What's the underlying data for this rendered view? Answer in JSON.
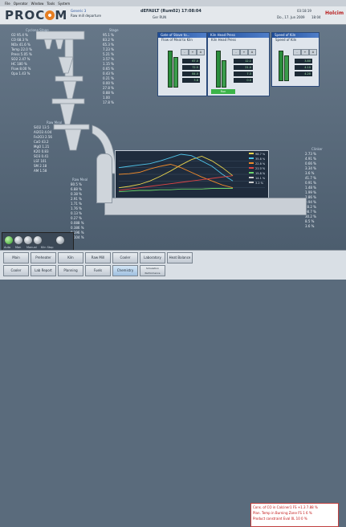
{
  "menu": [
    "File",
    "Operator",
    "Window",
    "Tools",
    "System"
  ],
  "header": {
    "app_name": "PROCEM",
    "left_lines": [
      "Generic 3",
      "Raw mill departure"
    ],
    "center_line1": "Rapid Analysis Departure",
    "title": "dEFAULT (Rum02) 17:08:04",
    "title_sub": "Ger RUN",
    "time": "03:18:19",
    "date": "Do., 17. Jun 2009",
    "date_sub": "18:04",
    "brand_right": "Holcim"
  },
  "panels": [
    {
      "title": "Gate of Stave to...",
      "sub": "Flow of Meal to Kiln",
      "values": [
        "67.0",
        "72.5",
        "84.0",
        "3.8"
      ]
    },
    {
      "title": "Kiln Head Press",
      "sub": "Kiln Head Press",
      "values": [
        "12.1",
        "21.0",
        "7.3",
        "0.0"
      ],
      "status": "Run"
    },
    {
      "title": "Speed of Kiln",
      "sub": "Speed of Kiln",
      "values": [
        "3.80",
        "4.10",
        "4.20",
        "6.0"
      ]
    }
  ],
  "left_values": {
    "header": "Cyclone Stage",
    "rows": [
      {
        "name": "O2",
        "val": "95.4 %"
      },
      {
        "name": "CO",
        "val": "68.3 %"
      },
      {
        "name": "NOx",
        "val": "41.6 %"
      },
      {
        "name": "Temp",
        "val": "22.0 %"
      },
      {
        "name": "Press",
        "val": "5.05 %"
      },
      {
        "name": "SO2",
        "val": "2.47 %"
      },
      {
        "name": "HC",
        "val": "180 %"
      },
      {
        "name": "Flow",
        "val": "8.00 %"
      },
      {
        "name": "Opa",
        "val": "1.43 %"
      }
    ]
  },
  "center_values": {
    "header": "Stage",
    "rows": [
      "95.1 %",
      "83.2 %",
      "65.3 %",
      "7.23 %",
      "5.21 %",
      "3.57 %",
      "1.15 %",
      "0.65 %",
      "0.43 %",
      "0.21 %",
      "0.00 %",
      "27.8 %",
      "0.88 %",
      "1.00",
      "17.8 %"
    ]
  },
  "lower_left": {
    "header": "Raw Meal",
    "rows": [
      {
        "name": "SiO2",
        "val": "13.5"
      },
      {
        "name": "Al2O3",
        "val": "4.04"
      },
      {
        "name": "Fe2O3",
        "val": "2.56"
      },
      {
        "name": "CaO",
        "val": "43.2"
      },
      {
        "name": "MgO",
        "val": "1.21"
      },
      {
        "name": "K2O",
        "val": "0.83"
      },
      {
        "name": "SO3",
        "val": "0.41"
      },
      {
        "name": "LSF",
        "val": "101"
      },
      {
        "name": "SM",
        "val": "2.18"
      },
      {
        "name": "AM",
        "val": "1.58"
      }
    ]
  },
  "lower_mid": {
    "header": "Raw Meal",
    "rows": [
      "80.5 %",
      "6.88 %",
      "0.38 %",
      "2.91 %",
      "1.71 %",
      "1.76 %",
      "0.13 %",
      "0.27 %",
      "0.088 %",
      "0.386 %",
      "0.196 %",
      "0.104 %"
    ]
  },
  "right_values": {
    "header": "Clinker",
    "rows": [
      "2.73 %",
      "4.91 %",
      "0.66 %",
      "3.34 %",
      "3.6 %",
      "41.7 %",
      "0.91 %",
      "1.48 %",
      "1.99 %",
      "2.86 %",
      "0.94 %",
      "28.2 %",
      "98.7 %",
      "30.2 %",
      "8.5 %",
      "3.6 %"
    ]
  },
  "chart_data": {
    "type": "line",
    "series": [
      {
        "name": "",
        "color": "#e8d44d",
        "values": [
          10,
          12,
          15,
          20,
          27,
          35,
          44,
          52,
          57,
          50,
          40,
          28
        ]
      },
      {
        "name": "",
        "color": "#4fc3e8",
        "values": [
          40,
          42,
          44,
          46,
          50,
          55,
          60,
          58,
          50,
          42,
          30,
          20
        ]
      },
      {
        "name": "",
        "color": "#f08a2a",
        "values": [
          30,
          31,
          33,
          38,
          42,
          45,
          40,
          33,
          26,
          20,
          14,
          10
        ]
      },
      {
        "name": "",
        "color": "#d44",
        "values": [
          6,
          8,
          10,
          12,
          14,
          16,
          18,
          20,
          22,
          24,
          26,
          28
        ]
      },
      {
        "name": "",
        "color": "#6bd46b",
        "values": [
          4,
          5,
          6,
          6,
          7,
          7,
          8,
          8,
          8,
          9,
          9,
          9
        ]
      }
    ],
    "legend": [
      "98.7 %",
      "35.8 %",
      "22.8 %",
      "21.0 %",
      "15.8 %",
      "14.1 %",
      "3.2 %"
    ]
  },
  "footer": {
    "row1": [
      "Main",
      "Preheater",
      "Kiln",
      "Raw Mill",
      "Cooler",
      "Laboratory",
      "Heat Balance"
    ],
    "row2": [
      "Cooler",
      "Lab Report",
      "Planning",
      "Fuels",
      "Chemistry",
      "Simulation Performance"
    ],
    "alarm_lines": [
      {
        "text": "Cons. of CO in Calciner1",
        "val": "FS +1.3",
        "c": "7.88 %"
      },
      {
        "text": "Plan. Temp in Burning Zone",
        "val": "FS 1",
        "c": "6 %"
      },
      {
        "text": "Product constraint Eval",
        "val": "0L 10",
        "c": "0 %"
      }
    ],
    "mode_labels": [
      "Auto",
      "Man",
      "Manual",
      "Kiln Stop"
    ]
  }
}
